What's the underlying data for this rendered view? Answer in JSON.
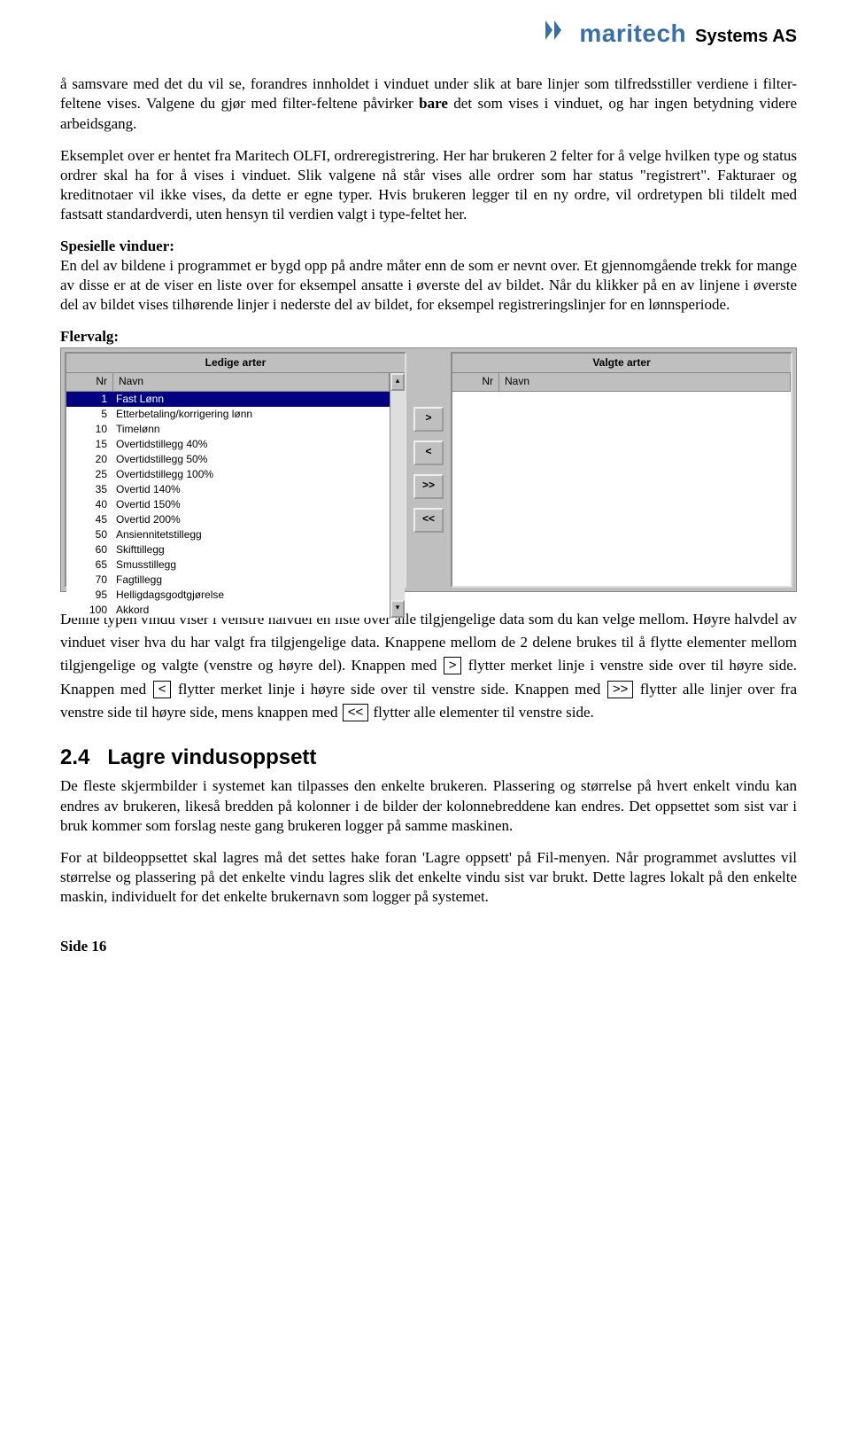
{
  "header": {
    "logo_text": "maritech",
    "logo_suffix": "Systems AS"
  },
  "para1_a": "å samsvare med det du vil se, forandres innholdet i vinduet under slik at bare linjer som tilfredsstiller verdiene i filter-feltene vises. Valgene du gjør med filter-feltene påvirker ",
  "para1_b": "bare",
  "para1_c": " det som vises i vinduet, og har ingen betydning videre arbeidsgang.",
  "para2": "Eksemplet over er hentet fra Maritech OLFI, ordreregistrering. Her har brukeren 2 felter for å velge hvilken type og status ordrer skal ha for å vises i vinduet. Slik valgene nå står vises alle ordrer som har status \"registrert\". Fakturaer og kreditnotaer vil ikke vises, da dette er egne typer. Hvis brukeren legger til en ny ordre, vil ordretypen bli tildelt med fastsatt standardverdi, uten hensyn til verdien valgt i type-feltet her.",
  "spesielle_h": "Spesielle vinduer:",
  "para3": "En del av bildene i programmet er bygd opp på andre måter enn de som er nevnt over. Et gjennomgående trekk for mange av disse er at de viser en liste over for eksempel ansatte i øverste del av bildet. Når du klikker på en av linjene i øverste del av bildet vises tilhørende linjer i nederste del av bildet, for eksempel registreringslinjer for en lønnsperiode.",
  "flervalg_h": "Flervalg:",
  "panel_left_title": "Ledige arter",
  "panel_right_title": "Valgte arter",
  "col_nr": "Nr",
  "col_navn": "Navn",
  "left_items": [
    {
      "nr": "1",
      "navn": "Fast Lønn",
      "selected": true
    },
    {
      "nr": "5",
      "navn": "Etterbetaling/korrigering lønn"
    },
    {
      "nr": "10",
      "navn": "Timelønn"
    },
    {
      "nr": "15",
      "navn": "Overtidstillegg 40%"
    },
    {
      "nr": "20",
      "navn": "Overtidstillegg 50%"
    },
    {
      "nr": "25",
      "navn": "Overtidstillegg 100%"
    },
    {
      "nr": "35",
      "navn": "Overtid 140%"
    },
    {
      "nr": "40",
      "navn": "Overtid 150%"
    },
    {
      "nr": "45",
      "navn": "Overtid 200%"
    },
    {
      "nr": "50",
      "navn": "Ansiennitetstillegg"
    },
    {
      "nr": "60",
      "navn": "Skifttillegg"
    },
    {
      "nr": "65",
      "navn": "Smusstillegg"
    },
    {
      "nr": "70",
      "navn": "Fagtillegg"
    },
    {
      "nr": "95",
      "navn": "Helligdagsgodtgjørelse"
    },
    {
      "nr": "100",
      "navn": "Akkord"
    }
  ],
  "btns": {
    "r1": ">",
    "l1": "<",
    "r2": ">>",
    "l2": "<<"
  },
  "para4_a": "Denne typen vindu viser i venstre halvdel en liste over alle tilgjengelige data som du kan velge mellom. Høyre halvdel av vinduet viser hva du har valgt fra tilgjengelige data. Knappene mellom de 2 delene brukes til å flytte elementer mellom tilgjengelige og valgte (venstre og høyre del). Knappen med ",
  "para4_b": " flytter merket linje i venstre side over til høyre side. Knappen med ",
  "para4_c": " flytter merket linje i høyre side over til venstre side. Knappen med ",
  "para4_d": " flytter alle linjer over fra venstre side til høyre side, mens knappen med ",
  "para4_e": " flytter alle elementer til venstre side.",
  "section_num": "2.4",
  "section_title": "Lagre vindusoppsett",
  "para5": "De fleste skjermbilder i systemet kan tilpasses den enkelte brukeren. Plassering og størrelse på hvert enkelt vindu kan endres av brukeren, likeså bredden på kolonner i de bilder der kolonnebreddene kan endres. Det oppsettet som sist var i bruk kommer som forslag neste gang brukeren logger på samme maskinen.",
  "para6": "For at bildeoppsettet skal lagres må det settes hake foran 'Lagre oppsett' på Fil-menyen. Når programmet avsluttes vil størrelse og plassering på det enkelte vindu lagres slik det enkelte vindu sist var brukt. Dette lagres lokalt på den enkelte maskin, individuelt for det enkelte brukernavn som logger på systemet.",
  "footer": "Side 16"
}
